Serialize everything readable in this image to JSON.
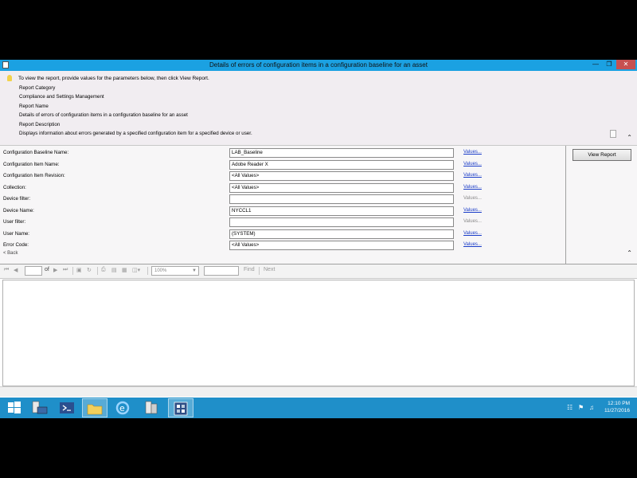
{
  "window": {
    "title": "Details of errors of configuration items in a configuration baseline for an asset",
    "minimize_icon": "minimize-icon",
    "restore_icon": "restore-icon",
    "close_icon": "close-icon"
  },
  "info": {
    "instruction": "To view the report, provide values for the parameters below, then click View Report.",
    "category_label": "Report Category",
    "category_value": "Compliance and Settings Management",
    "name_label": "Report Name",
    "name_value": "Details of errors of configuration items in a configuration baseline for an asset",
    "description_label": "Report Description",
    "description_value": "Displays information about errors generated by a specified configuration item for a specified device or user."
  },
  "params": [
    {
      "label": "Configuration Baseline Name:",
      "value": "LAB_Baseline",
      "link": "Values...",
      "enabled": true
    },
    {
      "label": "Configuration Item Name:",
      "value": "Adobe Reader X",
      "link": "Values...",
      "enabled": true
    },
    {
      "label": "Configuration Item Revision:",
      "value": "<All Values>",
      "link": "Values...",
      "enabled": true
    },
    {
      "label": "Collection:",
      "value": "<All Values>",
      "link": "Values...",
      "enabled": true
    },
    {
      "label": "Device filter:",
      "value": "",
      "link": "Values...",
      "enabled": false
    },
    {
      "label": "Device Name:",
      "value": "NYCCL1",
      "link": "Values...",
      "enabled": true
    },
    {
      "label": "User filter:",
      "value": "",
      "link": "Values...",
      "enabled": false
    },
    {
      "label": "User Name:",
      "value": "(SYSTEM)",
      "link": "Values...",
      "enabled": true
    },
    {
      "label": "Error Code:",
      "value": "<All Values>",
      "link": "Values...",
      "enabled": true
    }
  ],
  "back_label": "< Back",
  "view_report_label": "View Report",
  "toolbar": {
    "of_label": "of",
    "zoom": "100%",
    "find_label": "Find",
    "next_label": "Next"
  },
  "taskbar": {
    "time": "12:10 PM",
    "date": "11/27/2016"
  },
  "colors": {
    "titlebar": "#1ba1e2",
    "taskbar": "#1f8fc9",
    "link": "#1a3cc8"
  }
}
